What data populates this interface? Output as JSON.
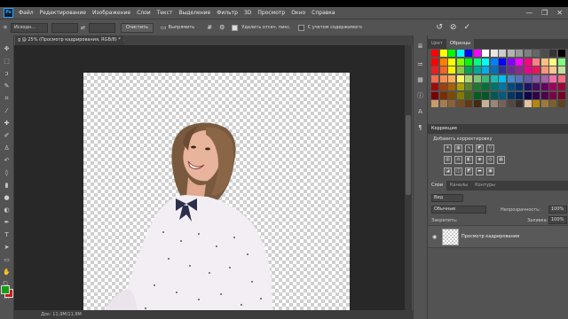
{
  "menu": {
    "logo": "Ps",
    "items": [
      "Файл",
      "Редактирование",
      "Изображение",
      "Слои",
      "Текст",
      "Выделение",
      "Фильтр",
      "3D",
      "Просмотр",
      "Окно",
      "Справка"
    ],
    "window_controls": [
      "—",
      "❐",
      "✕"
    ]
  },
  "options": {
    "preset": "Исходн...",
    "clear_button": "Очистить",
    "straighten_button": "Выпрямить",
    "delete_cropped_label": "Удалить отсеч. пикс.",
    "content_aware_label": "С учетом содержимого",
    "delete_cropped_checked": true,
    "content_aware_checked": false
  },
  "document": {
    "tab_title": "g @ 25% (Просмотр кадрирования, RGB/8) *",
    "close": "×",
    "status": "Док: 11,9M/11,9M"
  },
  "panels": {
    "swatches_tabs": [
      "Цвет",
      "Образцы"
    ],
    "swatches_active": "Образцы",
    "corrections_title": "Коррекция",
    "corrections_add_label": "Добавить корректировку",
    "layers_tabs": [
      "Слои",
      "Каналы",
      "Контуры"
    ],
    "layers_active": "Слои",
    "blend_mode": "Обычные",
    "opacity_label": "Непрозрачность:",
    "opacity_value": "100%",
    "lock_label": "Закрепить:",
    "fill_label": "Заливка:",
    "fill_value": "100%",
    "layer_name": "Просмотр кадрирования",
    "search_kind": "Вид"
  },
  "colors": {
    "foreground": "#12a012",
    "background": "#c51b1b",
    "app_bg": "#535353",
    "pasteboard": "#282828",
    "accent": "#31a8ff"
  }
}
